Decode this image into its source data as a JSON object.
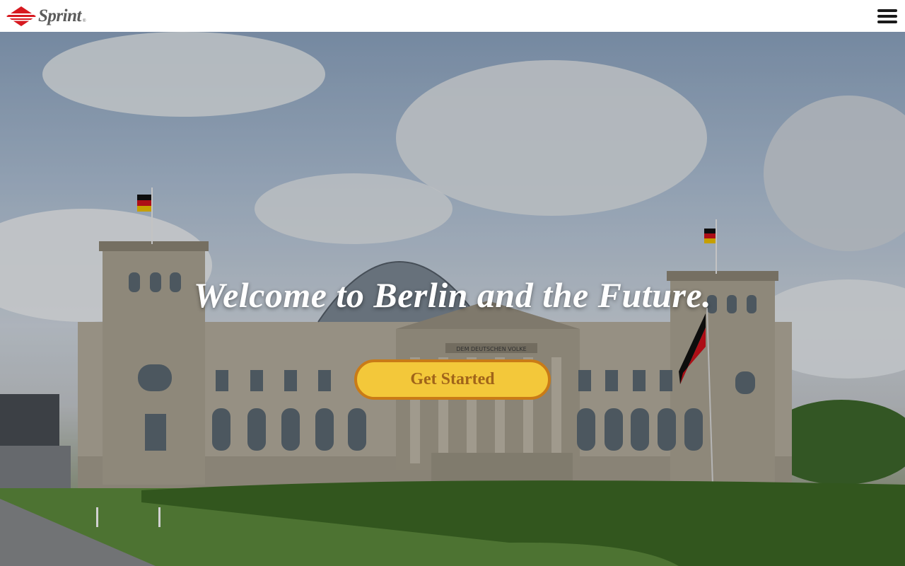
{
  "header": {
    "brand_name": "Sprint",
    "brand_mark": "®",
    "menu_icon": "hamburger-menu-icon"
  },
  "hero": {
    "title": "Welcome to Berlin and the Future.",
    "cta_label": "Get Started",
    "inscription": "DEM DEUTSCHEN VOLKE"
  },
  "colors": {
    "cta_fill": "#f3c83a",
    "cta_border": "#c97b17",
    "cta_text": "#a0641a",
    "logo_red": "#d71920",
    "logo_text": "#5b5b5b"
  }
}
